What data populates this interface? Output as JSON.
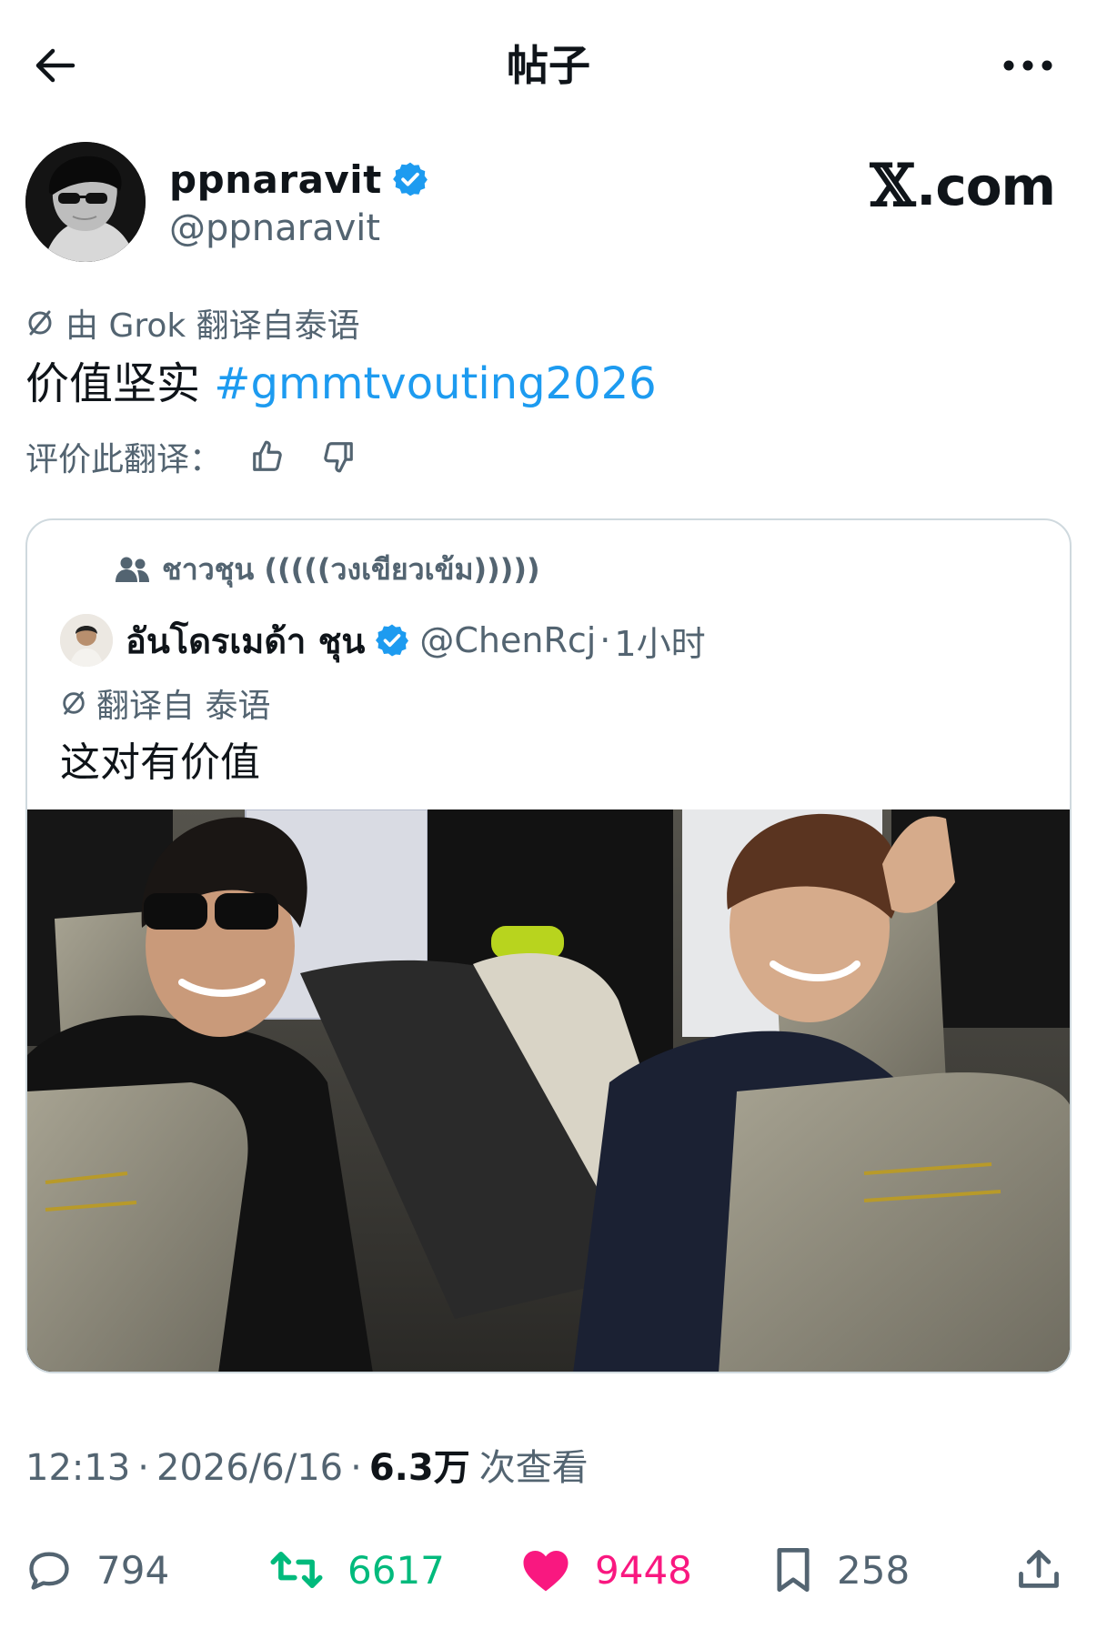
{
  "header": {
    "title": "帖子"
  },
  "author": {
    "name": "ppnaravit",
    "handle": "@ppnaravit",
    "verified": true
  },
  "watermark": {
    "glyph": "𝕏",
    "text": ".com"
  },
  "post": {
    "translation_note": "由 Grok 翻译自泰语",
    "text": "价值坚实",
    "hashtag": "#gmmtvouting2026",
    "rate_label": "评价此翻译："
  },
  "quote": {
    "community": "ชาวชุน (((((วงเขียวเข้ม)))))",
    "author_name": "อันโดรเมด้า ชุน",
    "handle": "@ChenRcj",
    "separator": "·",
    "time": "1小时",
    "translation_note": "翻译自 泰语",
    "text": "这对有价值"
  },
  "meta": {
    "time": "12:13",
    "sep1": "·",
    "date": "2026/6/16",
    "sep2": "·",
    "views": "6.3万",
    "views_label": "次查看"
  },
  "actions": {
    "replies": "794",
    "retweets": "6617",
    "likes": "9448",
    "bookmarks": "258"
  },
  "colors": {
    "accent": "#1d9bf0",
    "retweet": "#00ba7c",
    "like": "#f91880",
    "muted": "#536471",
    "text": "#0f1419",
    "border": "#cfd9de"
  }
}
